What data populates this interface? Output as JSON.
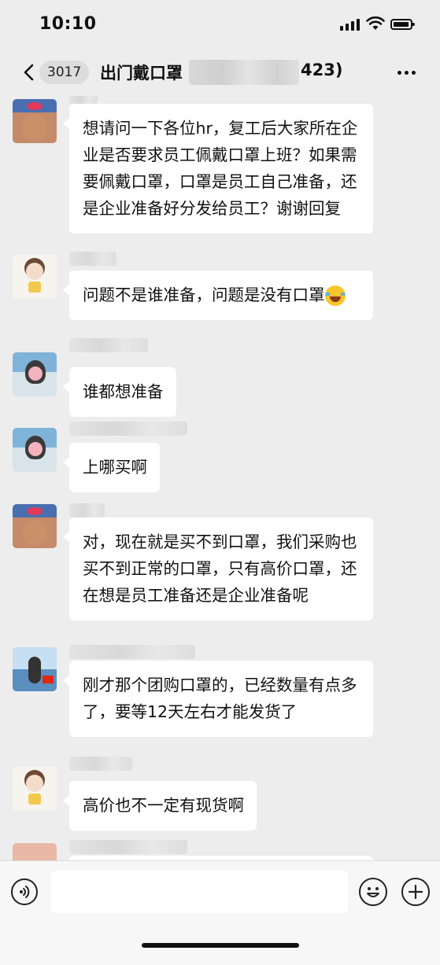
{
  "status_bar": {
    "time": "10:10",
    "icons": [
      "signal-icon",
      "wifi-icon",
      "battery-icon"
    ]
  },
  "nav": {
    "back_icon": "chevron-left-icon",
    "unread_count": "3017",
    "title_prefix": "出门戴口罩",
    "title_suffix": "423)",
    "more_icon": "more-dots-icon"
  },
  "messages": [
    {
      "avatar": "baby-avatar",
      "text": "想请问一下各位hr，复工后大家所在企业是否要求员工佩戴口罩上班？如果需要佩戴口罩，口罩是员工自己准备，还是企业准备好分发给员工？谢谢回复"
    },
    {
      "avatar": "girl-avatar",
      "text": "问题不是谁准备，问题是没有口罩",
      "emoji": "face-with-tears-of-joy-icon"
    },
    {
      "avatar": "woman-avatar",
      "text": "谁都想准备"
    },
    {
      "avatar": "woman-avatar",
      "text": "上哪买啊"
    },
    {
      "avatar": "baby-avatar",
      "text": "对，现在就是买不到口罩，我们采购也买不到正常的口罩，只有高价口罩，还在想是员工准备还是企业准备呢"
    },
    {
      "avatar": "beach-avatar",
      "text": "刚才那个团购口罩的，已经数量有点多了，要等12天左右才能发货了"
    },
    {
      "avatar": "girl-avatar",
      "text": "高价也不一定有现货啊"
    }
  ],
  "input_bar": {
    "voice_icon": "voice-icon",
    "input_value": "",
    "emoji_icon": "smiley-icon",
    "plus_icon": "plus-icon"
  }
}
